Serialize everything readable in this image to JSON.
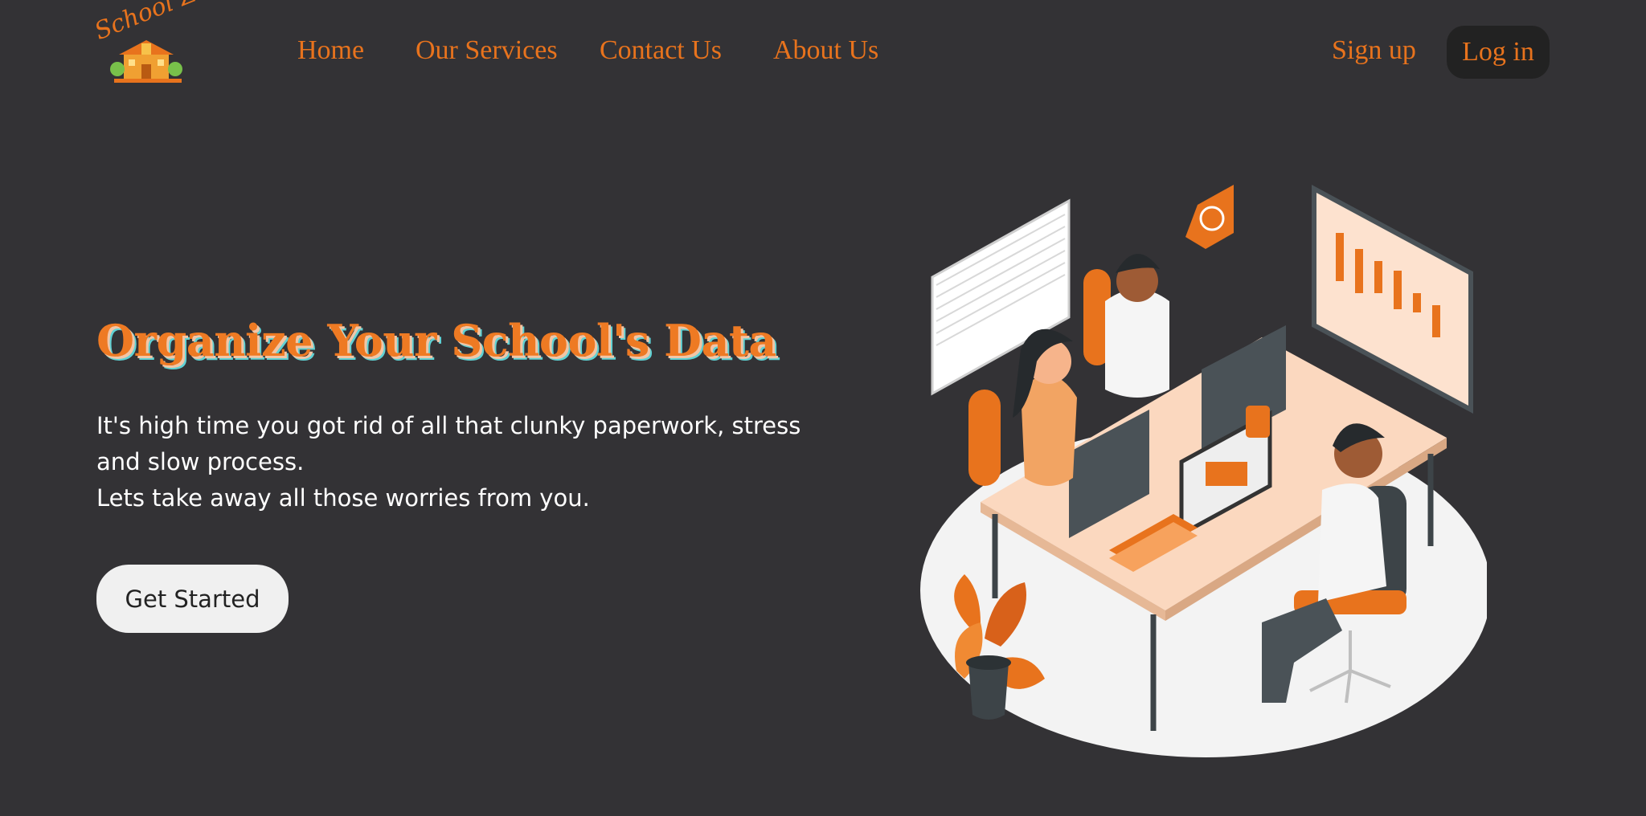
{
  "nav": {
    "logo_text": "School Zone",
    "links": [
      "Home",
      "Our Services",
      "Contact Us",
      "About Us"
    ],
    "signup": "Sign up",
    "login": "Log in"
  },
  "hero": {
    "title": "Organize Your School's Data",
    "line1": "It's high time you got rid of all that clunky paperwork, stress and slow process.",
    "line2": "Lets take away all those worries from you.",
    "cta": "Get Started"
  },
  "colors": {
    "background": "#333235",
    "accent": "#e8731d",
    "login_bg": "#222222",
    "button_bg": "#f0f0f0"
  }
}
